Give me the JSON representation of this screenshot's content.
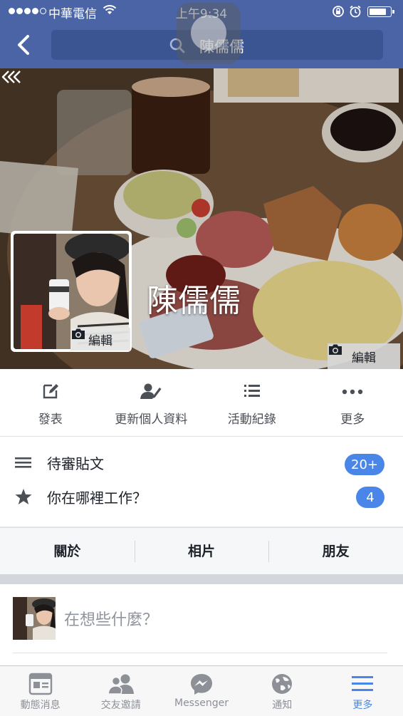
{
  "status_bar": {
    "carrier": "中華電信",
    "time": "上午9:34",
    "battery_level": 0.85
  },
  "nav": {
    "search_text": "陳儒儒"
  },
  "profile": {
    "name": "陳儒儒",
    "profile_edit_label": "編輯",
    "cover_edit_label": "編輯"
  },
  "actions": [
    {
      "label": "發表",
      "icon": "compose-icon"
    },
    {
      "label": "更新個人資料",
      "icon": "edit-profile-icon"
    },
    {
      "label": "活動紀錄",
      "icon": "activity-log-icon"
    },
    {
      "label": "更多",
      "icon": "more-icon"
    }
  ],
  "prompts": [
    {
      "label": "待審貼文",
      "badge": "20+",
      "icon": "menu-lines-icon"
    },
    {
      "label": "你在哪裡工作？",
      "badge": "4",
      "icon": "star-icon"
    }
  ],
  "tabs": [
    {
      "label": "關於"
    },
    {
      "label": "相片"
    },
    {
      "label": "朋友"
    }
  ],
  "composer": {
    "placeholder": "在想些什麼？"
  },
  "tabbar": [
    {
      "label": "動態消息",
      "icon": "news-feed-icon"
    },
    {
      "label": "交友邀請",
      "icon": "friend-requests-icon"
    },
    {
      "label": "Messenger",
      "icon": "messenger-icon"
    },
    {
      "label": "通知",
      "icon": "notifications-globe-icon"
    },
    {
      "label": "更多",
      "icon": "hamburger-icon",
      "active": true
    }
  ],
  "colors": {
    "nav_blue": "#4a64a5",
    "accent_blue": "#4a86e8"
  }
}
